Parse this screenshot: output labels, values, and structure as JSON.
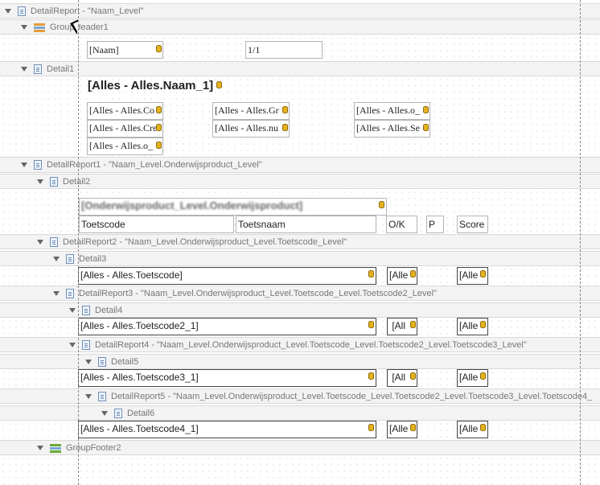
{
  "bands": {
    "detail_report": "DetailReport - \"Naam_Level\"",
    "group_header1": "GroupHeader1",
    "detail1": "Detail1",
    "detail_report1": "DetailReport1 - \"Naam_Level.Onderwijsproduct_Level\"",
    "detail2": "Detail2",
    "detail_report2": "DetailReport2 - \"Naam_Level.Onderwijsproduct_Level.Toetscode_Level\"",
    "detail3": "Detail3",
    "detail_report3": "DetailReport3 - \"Naam_Level.Onderwijsproduct_Level.Toetscode_Level.Toetscode2_Level\"",
    "detail4": "Detail4",
    "detail_report4": "DetailReport4 - \"Naam_Level.Onderwijsproduct_Level.Toetscode_Level.Toetscode2_Level.Toetscode3_Level\"",
    "detail5": "Detail5",
    "detail_report5": "DetailReport5 - \"Naam_Level.Onderwijsproduct_Level.Toetscode_Level.Toetscode2_Level.Toetscode3_Level.Toetscode4_",
    "detail6": "Detail6",
    "group_footer2": "GroupFooter2"
  },
  "fields": {
    "naam": "[Naam]",
    "page": "1/1",
    "naam1": "[Alles - Alles.Naam_1]",
    "co": "[Alles - Alles.Co",
    "cre": "[Alles - Alles.Cre",
    "o1": "[Alles - Alles.o_",
    "gr": "[Alles - Alles.Gr",
    "nu": "[Alles - Alles.nu",
    "o2": "[Alles - Alles.o_",
    "se": "[Alles - Alles.Se",
    "onderwijsproduct": "[Onderwijsproduct_Level.Onderwijsproduct]",
    "toetscode_label": "Toetscode",
    "toetsnaam_label": "Toetsnaam",
    "ok_label": "O/K",
    "p_label": "P",
    "score_label": "Score",
    "toetscode": "[Alles - Alles.Toetscode]",
    "toetscode2": "[Alles - Alles.Toetscode2_1]",
    "toetscode3": "[Alles - Alles.Toetscode3_1]",
    "toetscode4": "[Alles - Alles.Toetscode4_1]",
    "alle": "[Alle",
    "all": "[All"
  }
}
